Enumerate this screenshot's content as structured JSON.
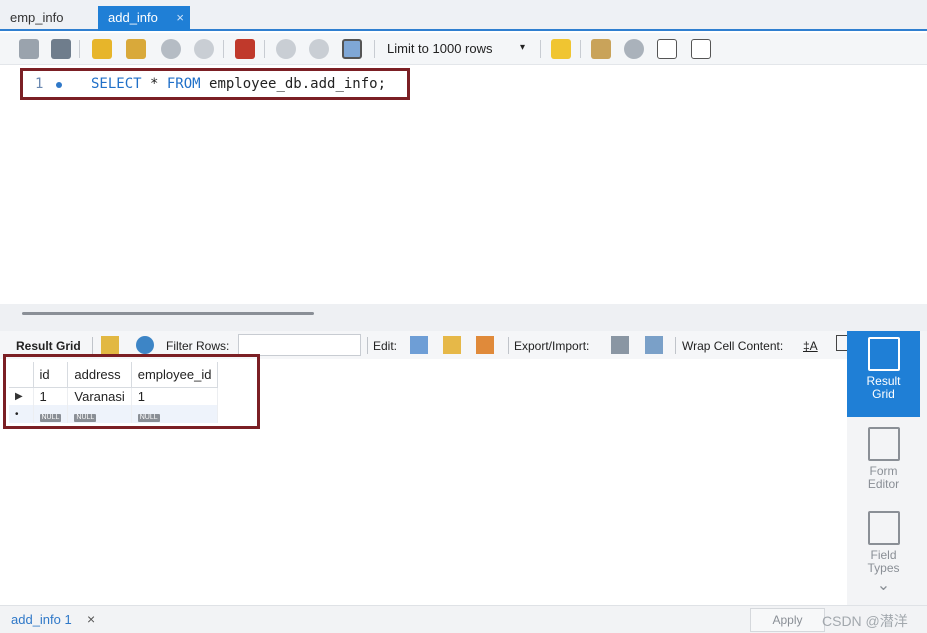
{
  "tabs": [
    {
      "label": "emp_info",
      "active": false
    },
    {
      "label": "add_info",
      "active": true,
      "close": "×"
    }
  ],
  "toolbar": {
    "limit_label": "Limit to 1000 rows",
    "limit_caret": "▾"
  },
  "editor": {
    "line_number": "1",
    "keyword_select": "SELECT",
    "star": " * ",
    "keyword_from": "FROM",
    "table_ref": " employee_db.add_info;"
  },
  "result_toolbar": {
    "result_grid_label": "Result Grid",
    "filter_rows_label": "Filter Rows:",
    "filter_value": "",
    "edit_label": "Edit:",
    "export_label": "Export/Import:",
    "wrap_label": "Wrap Cell Content:",
    "wrap_icon": "‡A"
  },
  "grid": {
    "columns": [
      "id",
      "address",
      "employee_id"
    ],
    "rows": [
      {
        "marker": "▶",
        "cells": [
          "1",
          "Varanasi",
          "1"
        ]
      }
    ],
    "null_label": "NULL",
    "new_row_marker": "•"
  },
  "side_panel": [
    {
      "label_line1": "Result",
      "label_line2": "Grid",
      "active": true
    },
    {
      "label_line1": "Form",
      "label_line2": "Editor",
      "active": false
    },
    {
      "label_line1": "Field",
      "label_line2": "Types",
      "active": false
    }
  ],
  "side_panel_more": "⌄",
  "bottom": {
    "tab_label": "add_info 1",
    "tab_close": "×",
    "apply_label": "Apply",
    "watermark": "CSDN @潜洋"
  },
  "colors": {
    "accent": "#1f7fd6",
    "highlight_frame": "#7b1f24",
    "keyword": "#2070c8"
  }
}
